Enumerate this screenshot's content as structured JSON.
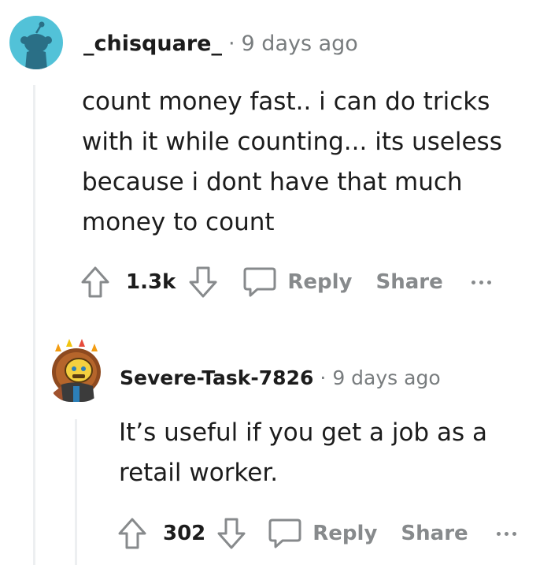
{
  "comments": [
    {
      "username": "_chisquare_",
      "separator": "·",
      "time": "9 days ago",
      "body_lines": [
        "count money fast.. i can do tricks",
        "with it while counting... its useless",
        "because i dont have that much",
        "money to count"
      ],
      "score": "1.3k",
      "reply_label": "Reply",
      "share_label": "Share",
      "avatar_icon": "reddit-snoo-avatar"
    },
    {
      "username": "Severe-Task-7826",
      "separator": "·",
      "time": "9 days ago",
      "body_lines": [
        "It’s useful if you get a job as a",
        "retail worker."
      ],
      "score": "302",
      "reply_label": "Reply",
      "share_label": "Share",
      "avatar_icon": "knight-character-avatar"
    }
  ],
  "colors": {
    "snoo_bg": "#52c2d8",
    "thread_line": "#edeff1",
    "meta_gray": "#787c7e",
    "action_gray": "#878a8c"
  }
}
